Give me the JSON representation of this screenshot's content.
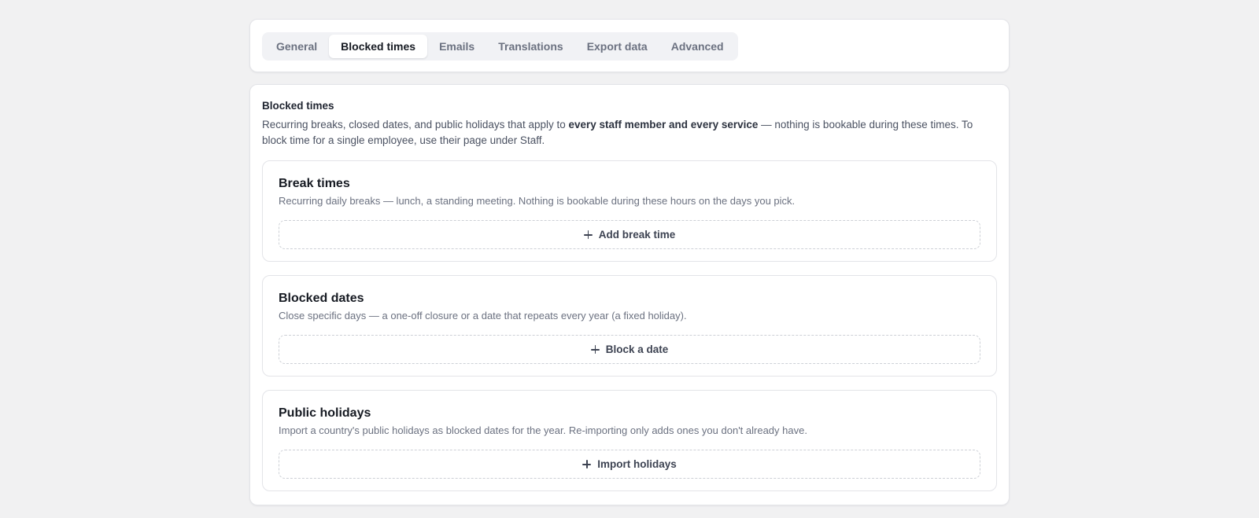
{
  "tabs": [
    {
      "label": "General",
      "active": false
    },
    {
      "label": "Blocked times",
      "active": true
    },
    {
      "label": "Emails",
      "active": false
    },
    {
      "label": "Translations",
      "active": false
    },
    {
      "label": "Export data",
      "active": false
    },
    {
      "label": "Advanced",
      "active": false
    }
  ],
  "section": {
    "title": "Blocked times",
    "desc_before": "Recurring breaks, closed dates, and public holidays that apply to ",
    "desc_bold": "every staff member and every service",
    "desc_after": " — nothing is bookable during these times. To block time for a single employee, use their page under Staff."
  },
  "break_times": {
    "title": "Break times",
    "desc": "Recurring daily breaks — lunch, a standing meeting. Nothing is bookable during these hours on the days you pick.",
    "button": "Add break time"
  },
  "blocked_dates": {
    "title": "Blocked dates",
    "desc": "Close specific days — a one-off closure or a date that repeats every year (a fixed holiday).",
    "button": "Block a date"
  },
  "public_holidays": {
    "title": "Public holidays",
    "desc": "Import a country's public holidays as blocked dates for the year. Re-importing only adds ones you don't already have.",
    "button": "Import holidays"
  },
  "icons": {
    "add": "plus-icon"
  }
}
